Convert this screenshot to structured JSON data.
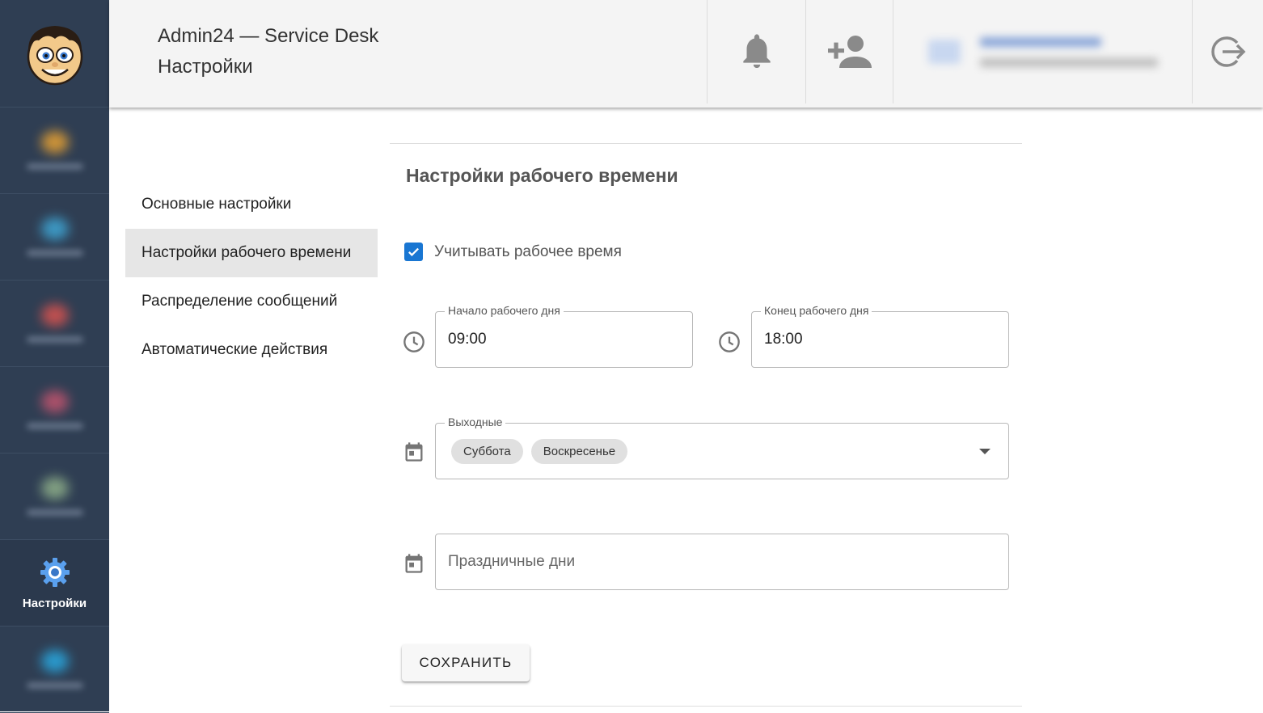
{
  "header": {
    "app_title": "Admin24 — Service Desk",
    "page_title": "Настройки"
  },
  "sidebar": {
    "items": [
      {
        "label": "",
        "color": "#e8a233"
      },
      {
        "label": "",
        "color": "#3fa7d6"
      },
      {
        "label": "",
        "color": "#d9534f"
      },
      {
        "label": "",
        "color": "#c0546e"
      },
      {
        "label": "",
        "color": "#8fb08a"
      },
      {
        "label": "Настройки",
        "icon": "gear-icon"
      },
      {
        "label": "",
        "color": "#29a9e1"
      }
    ]
  },
  "settings_menu": {
    "items": [
      {
        "label": "Основные настройки"
      },
      {
        "label": "Настройки рабочего времени"
      },
      {
        "label": "Распределение сообщений"
      },
      {
        "label": "Автоматические действия"
      }
    ],
    "active_index": 1
  },
  "section": {
    "title": "Настройки рабочего времени",
    "checkbox_label": "Учитывать рабочее время",
    "checkbox_checked": true,
    "start": {
      "legend": "Начало рабочего дня",
      "value": "09:00"
    },
    "end": {
      "legend": "Конец рабочего дня",
      "value": "18:00"
    },
    "weekends": {
      "legend": "Выходные",
      "chips": [
        "Суббота",
        "Воскресенье"
      ]
    },
    "holidays": {
      "placeholder": "Праздничные дни"
    },
    "save_label": "СОХРАНИТЬ"
  },
  "colors": {
    "sidebar_bg": "#2f3e53",
    "accent": "#1976d2",
    "header_bg": "#f4f4f4"
  }
}
